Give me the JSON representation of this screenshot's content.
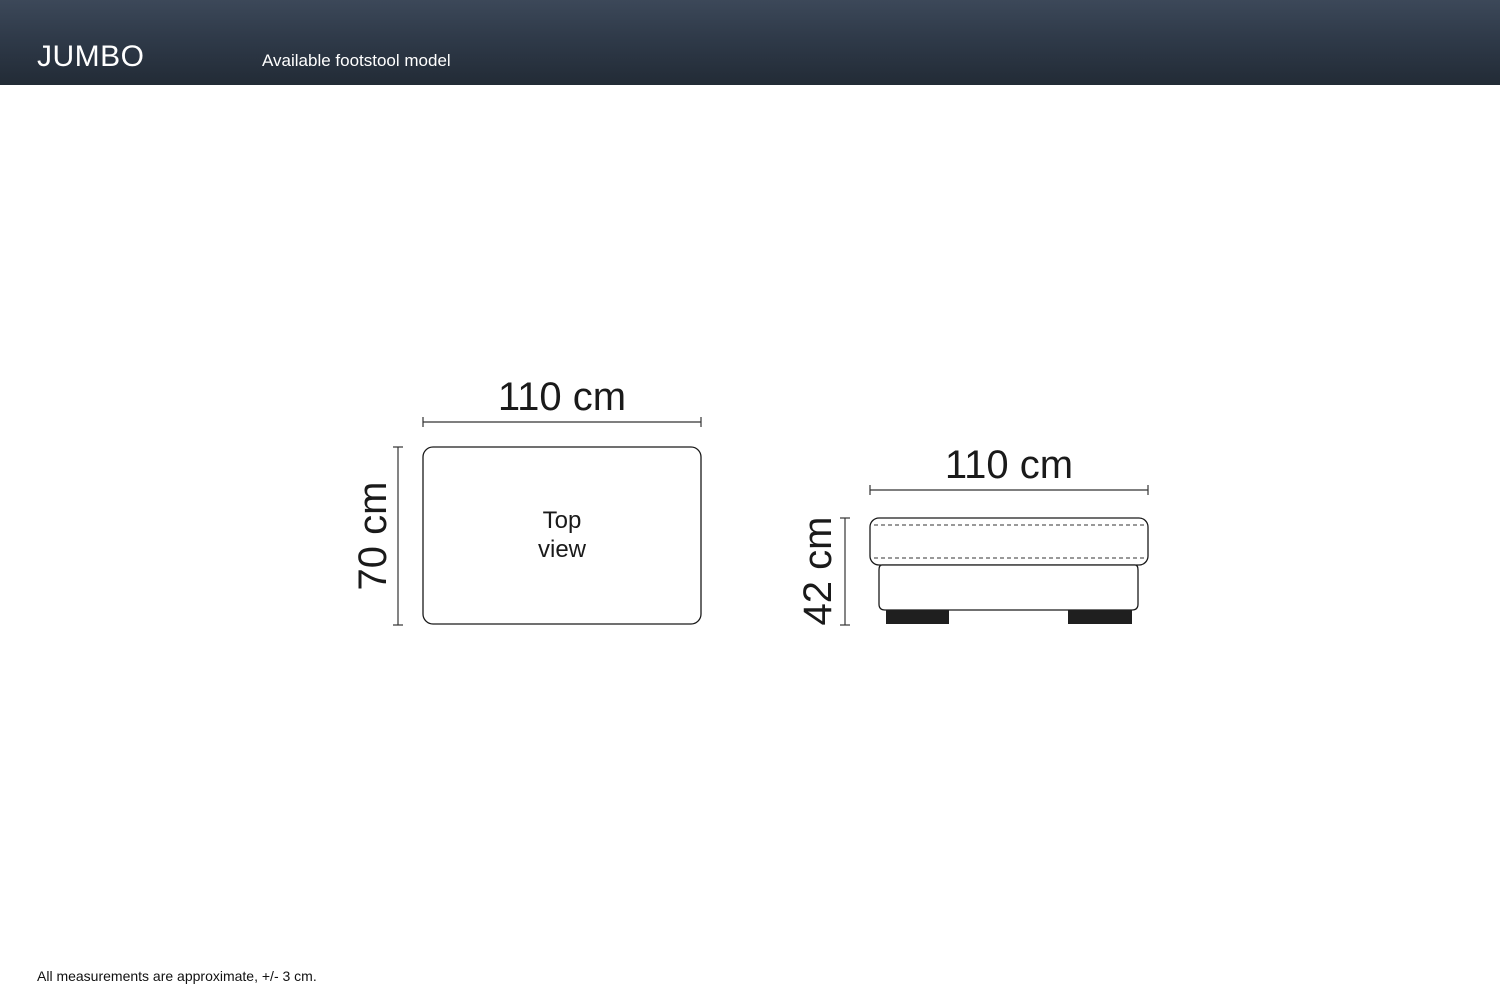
{
  "header": {
    "title": "JUMBO",
    "subtitle": "Available footstool model",
    "background_color": "#2f3a49"
  },
  "top_view": {
    "label_line1": "Top",
    "label_line2": "view",
    "width_label": "110 cm",
    "depth_label": "70 cm"
  },
  "side_view": {
    "width_label": "110 cm",
    "height_label": "42 cm"
  },
  "footer": {
    "note": "All measurements are approximate, +/- 3 cm."
  }
}
